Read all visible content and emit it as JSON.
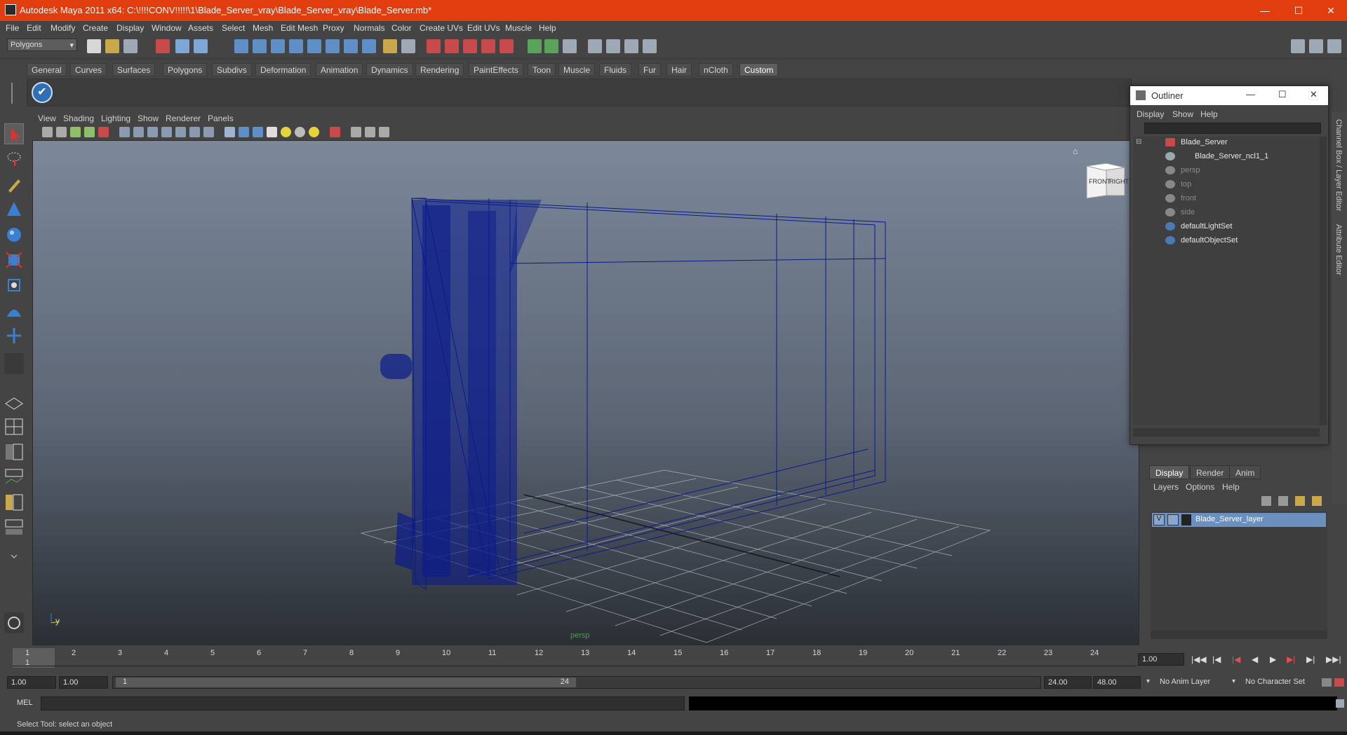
{
  "window": {
    "title": "Autodesk Maya 2011 x64: C:\\!!!!CONV!!!!!\\1\\Blade_Server_vray\\Blade_Server_vray\\Blade_Server.mb*",
    "minimize": "—",
    "maximize": "☐",
    "close": "✕"
  },
  "menubar": [
    "File",
    "Edit",
    "Modify",
    "Create",
    "Display",
    "Window",
    "Assets",
    "Select",
    "Mesh",
    "Edit Mesh",
    "Proxy",
    "Normals",
    "Color",
    "Create UVs",
    "Edit UVs",
    "Muscle",
    "Help"
  ],
  "statusline": {
    "mode": "Polygons"
  },
  "shelf_tabs": [
    "General",
    "Curves",
    "Surfaces",
    "Polygons",
    "Subdivs",
    "Deformation",
    "Animation",
    "Dynamics",
    "Rendering",
    "PaintEffects",
    "Toon",
    "Muscle",
    "Fluids",
    "Fur",
    "Hair",
    "nCloth",
    "Custom"
  ],
  "shelf_active": "Custom",
  "panel_menus": [
    "View",
    "Shading",
    "Lighting",
    "Show",
    "Renderer",
    "Panels"
  ],
  "viewport": {
    "camera": "persp",
    "viewcube_front": "FRONT",
    "viewcube_right": "RIGHT",
    "axis_label": "y"
  },
  "outliner": {
    "title": "Outliner",
    "menus": [
      "Display",
      "Show",
      "Help"
    ],
    "items": [
      {
        "label": "Blade_Server",
        "dim": false,
        "icon": "mesh-icon"
      },
      {
        "label": "Blade_Server_ncl1_1",
        "dim": false,
        "icon": "ncloth-icon"
      },
      {
        "label": "persp",
        "dim": true,
        "icon": "camera-icon"
      },
      {
        "label": "top",
        "dim": true,
        "icon": "camera-icon"
      },
      {
        "label": "front",
        "dim": true,
        "icon": "camera-icon"
      },
      {
        "label": "side",
        "dim": true,
        "icon": "camera-icon"
      },
      {
        "label": "defaultLightSet",
        "dim": false,
        "icon": "set-icon"
      },
      {
        "label": "defaultObjectSet",
        "dim": false,
        "icon": "set-icon"
      }
    ]
  },
  "right_strip": {
    "channel_box": "Channel Box / Layer Editor",
    "attribute_editor": "Attribute Editor"
  },
  "layer_editor": {
    "tabs": [
      "Display",
      "Render",
      "Anim"
    ],
    "active_tab": "Display",
    "menus": [
      "Layers",
      "Options",
      "Help"
    ],
    "layer": {
      "visibility": "V",
      "name": "Blade_Server_layer"
    }
  },
  "timeslider": {
    "ticks": [
      "1",
      "2",
      "3",
      "4",
      "5",
      "6",
      "7",
      "8",
      "9",
      "10",
      "11",
      "12",
      "13",
      "14",
      "15",
      "16",
      "17",
      "18",
      "19",
      "20",
      "21",
      "22",
      "23",
      "24"
    ],
    "current_frame": "1",
    "current_time_field": "1.00"
  },
  "range": {
    "start": "1.00",
    "playback_start": "1.00",
    "range_start_label": "1",
    "range_end_label": "24",
    "playback_end": "24.00",
    "end": "48.00",
    "anim_layer": "No Anim Layer",
    "character_set": "No Character Set"
  },
  "cmdline": {
    "label": "MEL"
  },
  "helpline": {
    "text": "Select Tool: select an object"
  },
  "colors": {
    "title_bar": "#e13d0e",
    "wireframe": "#0a1a8c",
    "layer_selected": "#6b8fbf"
  }
}
